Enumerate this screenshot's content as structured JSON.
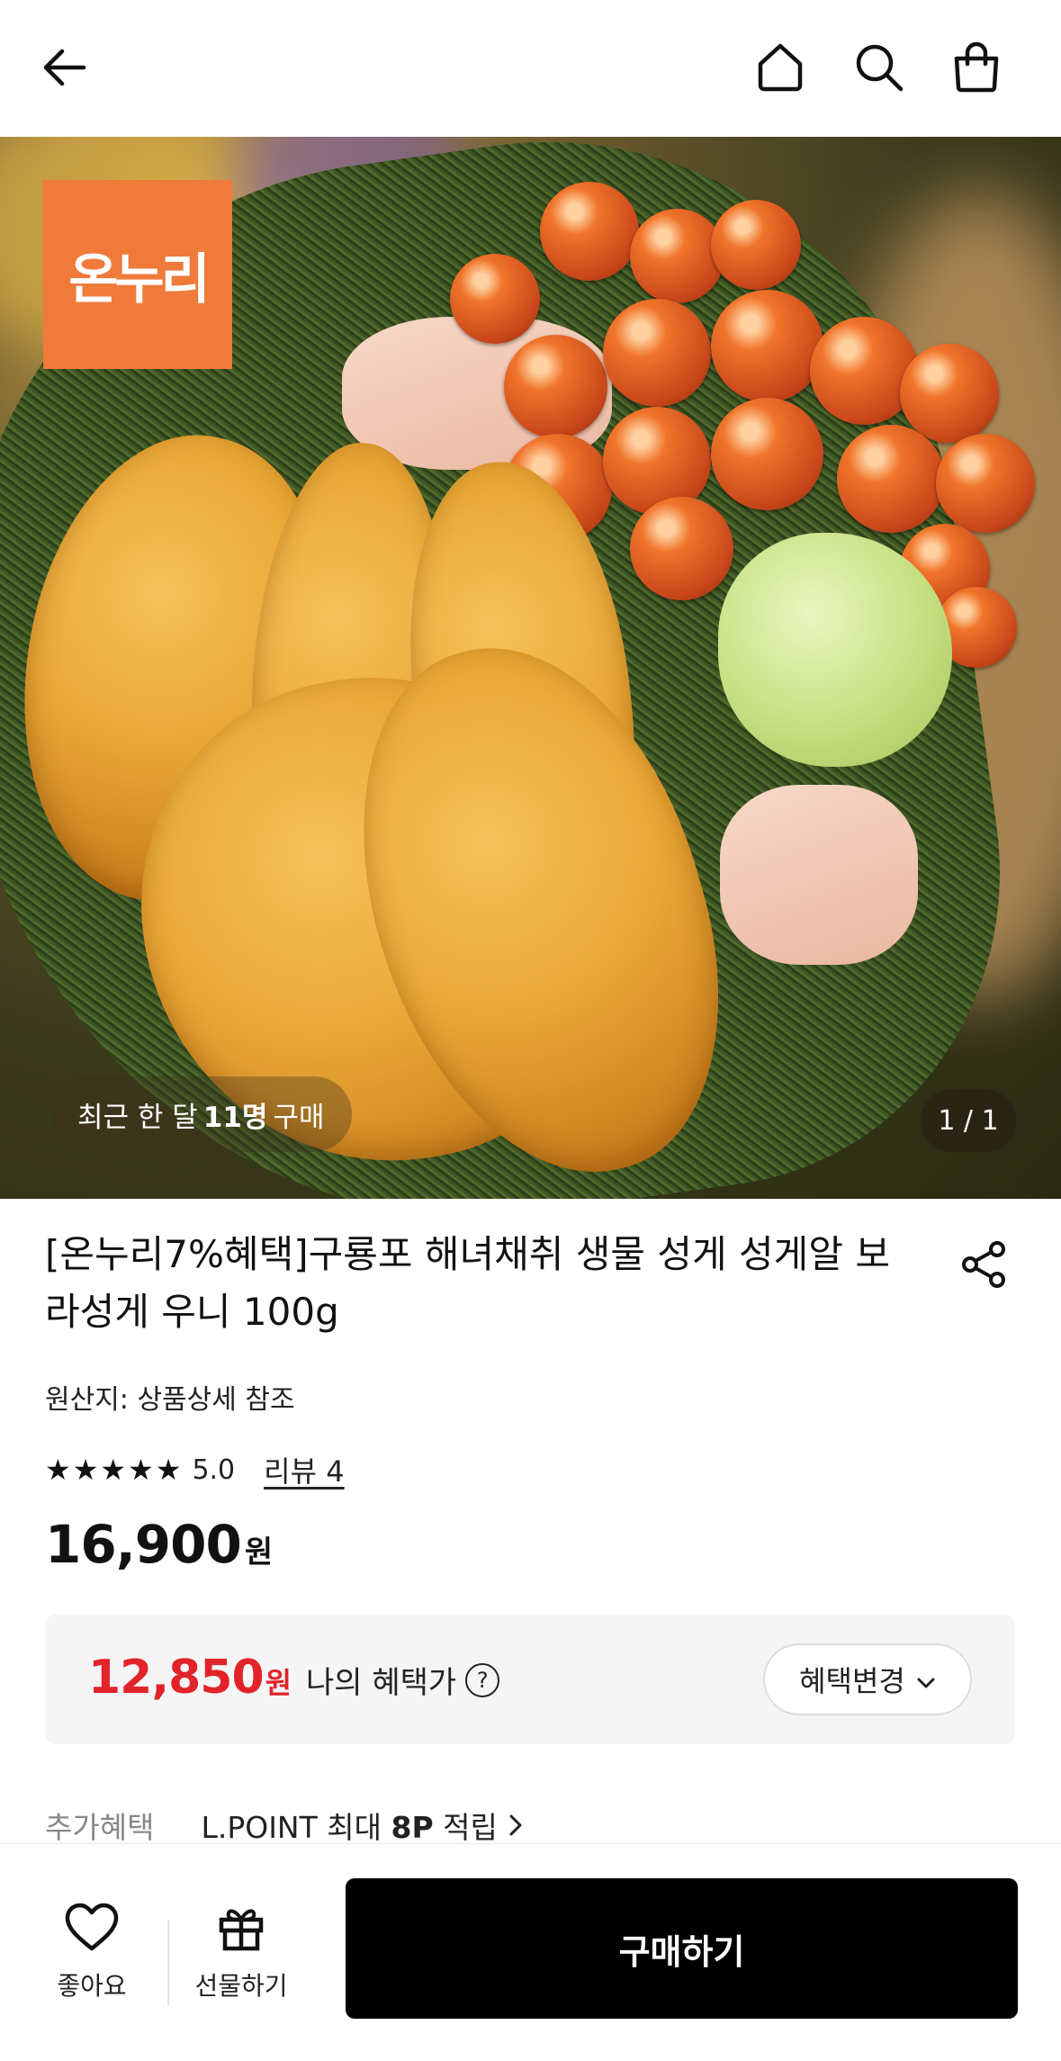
{
  "header": {
    "icons": [
      "back-arrow-icon",
      "home-icon",
      "search-icon",
      "shopping-bag-icon"
    ]
  },
  "hero": {
    "logo_text": "온누리",
    "recent_purchase": {
      "prefix": "최근 한 달",
      "count": "11명",
      "suffix": "구매"
    },
    "image_counter": "1 / 1"
  },
  "product": {
    "title": "[온누리7%혜택]구룡포 해녀채취 생물 성게 성게알 보라성게 우니 100g",
    "origin": "원산지: 상품상세 참조",
    "rating": {
      "stars": "★★★★★",
      "score": "5.0",
      "review_link": "리뷰 4"
    },
    "price": {
      "amount": "16,900",
      "unit": "원"
    }
  },
  "benefit": {
    "price": "12,850",
    "unit": "원",
    "label": "나의 혜택가",
    "help": "?",
    "change_button": "혜택변경"
  },
  "extra_benefit": {
    "label": "추가혜택",
    "text_prefix": "L.POINT 최대",
    "text_bold": "8P",
    "text_suffix": "적립"
  },
  "bottom_bar": {
    "like_label": "좋아요",
    "gift_label": "선물하기",
    "buy_label": "구매하기"
  },
  "colors": {
    "accent_red": "#e2232a",
    "logo_orange": "#ef7a3a",
    "buy_button": "#000000"
  }
}
